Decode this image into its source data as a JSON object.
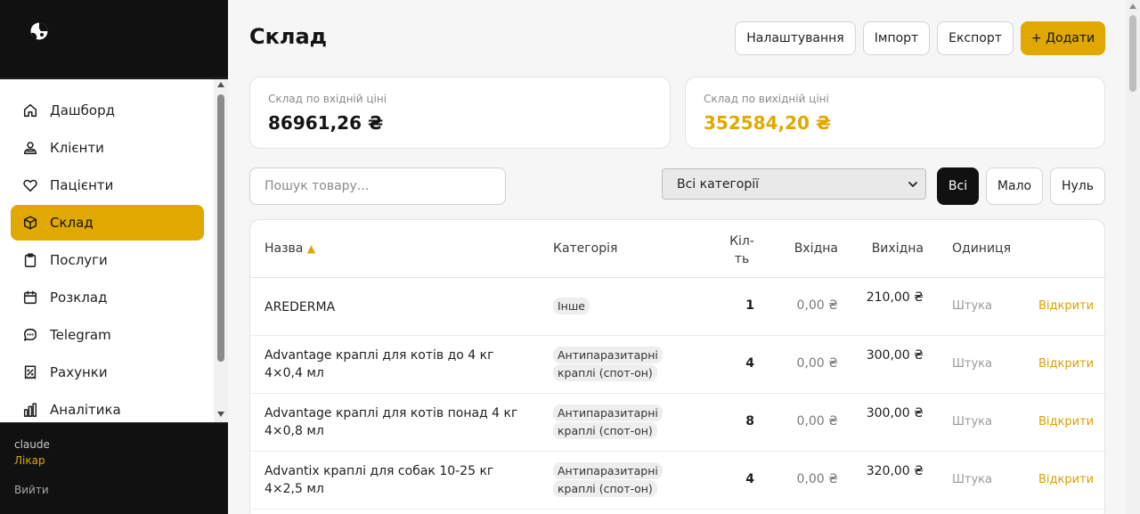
{
  "sidebar": {
    "nav": [
      {
        "label": "Дашборд",
        "icon": "home-icon"
      },
      {
        "label": "Клієнти",
        "icon": "users-icon"
      },
      {
        "label": "Пацієнти",
        "icon": "heart-icon"
      },
      {
        "label": "Склад",
        "icon": "box-icon",
        "active": true
      },
      {
        "label": "Послуги",
        "icon": "clipboard-icon"
      },
      {
        "label": "Розклад",
        "icon": "calendar-icon"
      },
      {
        "label": "Telegram",
        "icon": "chat-icon"
      },
      {
        "label": "Рахунки",
        "icon": "receipt-icon"
      },
      {
        "label": "Аналітика",
        "icon": "chart-icon"
      }
    ],
    "user": {
      "name": "claude",
      "role": "Лікар",
      "logout": "Вийти"
    }
  },
  "header": {
    "title": "Склад",
    "buttons": {
      "settings": "Налаштування",
      "import": "Імпорт",
      "export": "Експорт",
      "add": "+ Додати"
    }
  },
  "stats": {
    "in": {
      "label": "Склад по вхідній ціні",
      "value": "86961,26 ₴"
    },
    "out": {
      "label": "Склад по вихідній ціні",
      "value": "352584,20 ₴"
    }
  },
  "filters": {
    "search_placeholder": "Пошук товару...",
    "category": "Всі категорії",
    "all": "Всі",
    "low": "Мало",
    "zero": "Нуль"
  },
  "table": {
    "columns": {
      "name": "Назва",
      "sort": "▲",
      "category": "Категорія",
      "qty": "Кіл-ть",
      "in": "Вхідна",
      "out": "Вихідна",
      "unit": "Одиниця"
    },
    "rows": [
      {
        "name": "AREDERMA",
        "category": "Інше",
        "qty": "1",
        "in": "0,00 ₴",
        "out": "210,00 ₴",
        "unit": "Штука",
        "action": "Відкрити"
      },
      {
        "name": "Advantage краплі для котів до 4 кг 4×0,4 мл",
        "category": "Антипаразитарні краплі (спот-он)",
        "qty": "4",
        "in": "0,00 ₴",
        "out": "300,00 ₴",
        "unit": "Штука",
        "action": "Відкрити"
      },
      {
        "name": "Advantage краплі для котів понад 4 кг 4×0,8 мл",
        "category": "Антипаразитарні краплі (спот-он)",
        "qty": "8",
        "in": "0,00 ₴",
        "out": "300,00 ₴",
        "unit": "Штука",
        "action": "Відкрити"
      },
      {
        "name": "Advantix краплі для собак 10-25 кг 4×2,5 мл",
        "category": "Антипаразитарні краплі (спот-он)",
        "qty": "4",
        "in": "0,00 ₴",
        "out": "320,00 ₴",
        "unit": "Штука",
        "action": "Відкрити"
      }
    ]
  }
}
